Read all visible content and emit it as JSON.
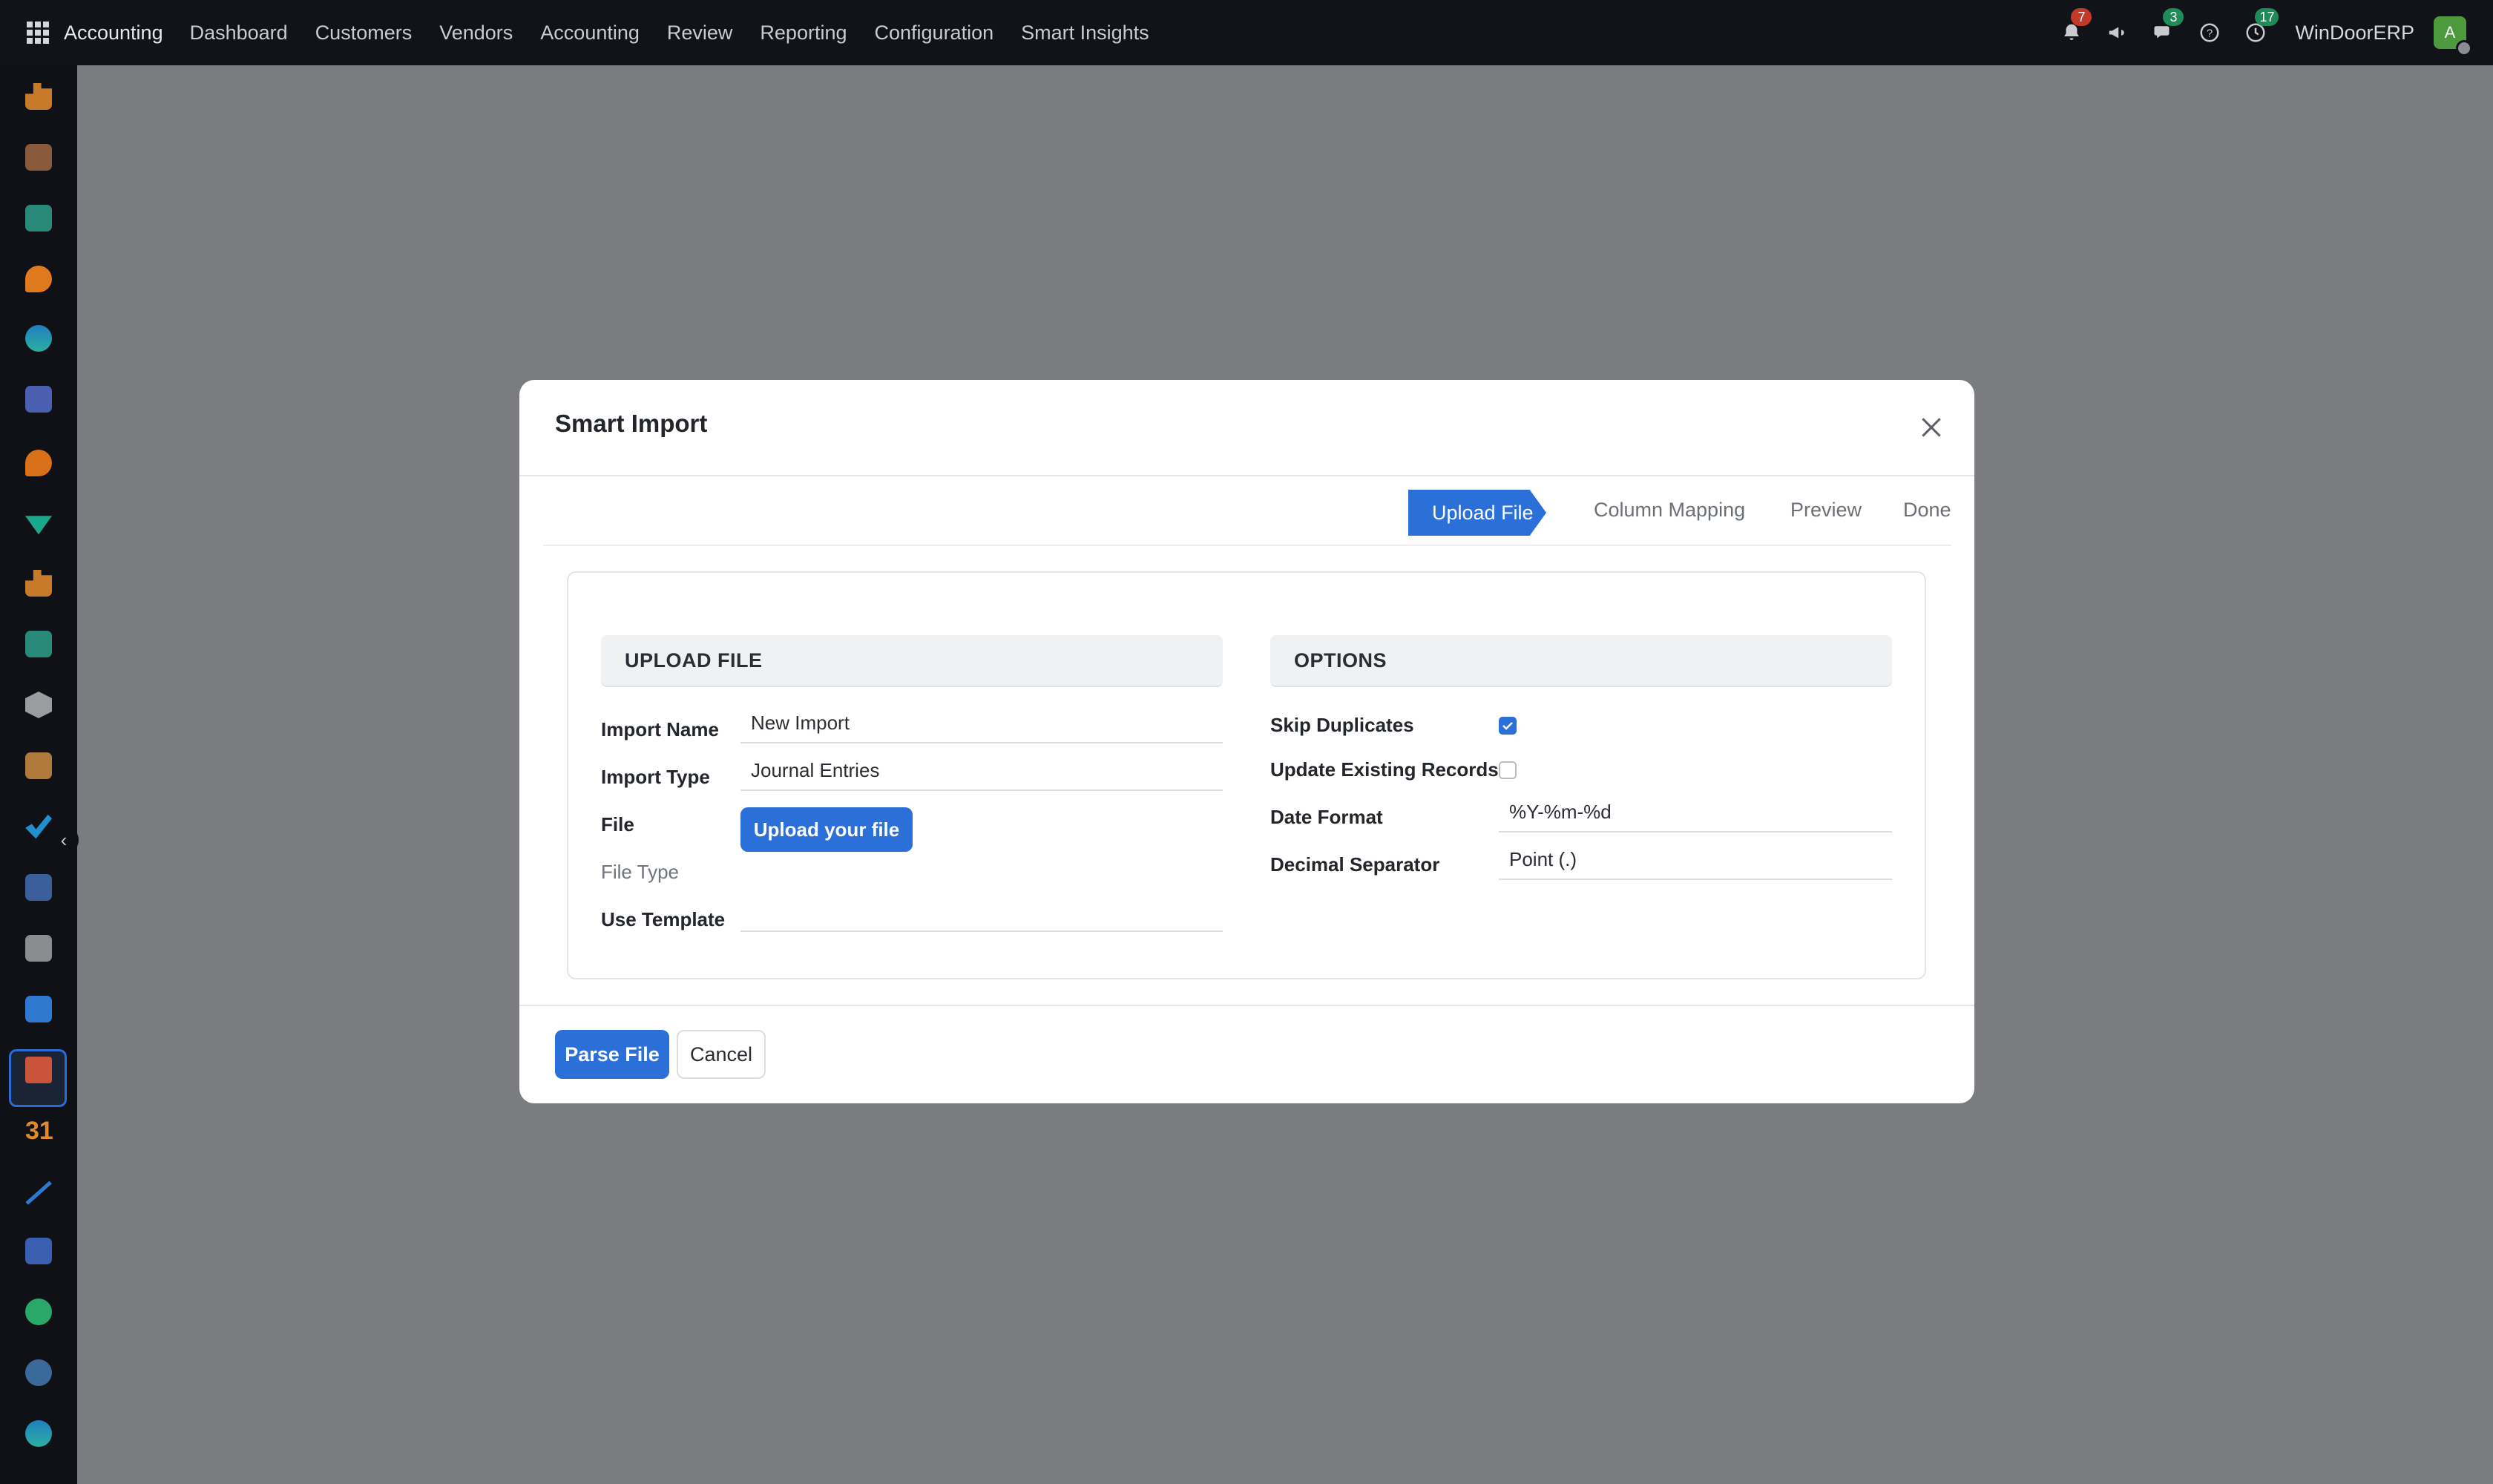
{
  "topbar": {
    "app_name": "Accounting",
    "nav": [
      "Dashboard",
      "Customers",
      "Vendors",
      "Accounting",
      "Review",
      "Reporting",
      "Configuration",
      "Smart Insights"
    ],
    "notifications_count": "7",
    "messages_count": "3",
    "activities_count": "17",
    "company": "WinDoorERP",
    "avatar_initial": "A"
  },
  "modal": {
    "title": "Smart Import",
    "steps": {
      "upload": "Upload File",
      "mapping": "Column Mapping",
      "preview": "Preview",
      "done": "Done"
    },
    "upload_section": {
      "title": "UPLOAD FILE",
      "import_name_label": "Import Name",
      "import_name_value": "New Import",
      "import_type_label": "Import Type",
      "import_type_value": "Journal Entries",
      "file_label": "File",
      "upload_button": "Upload your file",
      "file_type_label": "File Type",
      "use_template_label": "Use Template",
      "use_template_value": ""
    },
    "options_section": {
      "title": "OPTIONS",
      "skip_duplicates_label": "Skip Duplicates",
      "skip_duplicates_checked": true,
      "update_existing_label": "Update Existing Records",
      "update_existing_checked": false,
      "date_format_label": "Date Format",
      "date_format_value": "%Y-%m-%d",
      "decimal_separator_label": "Decimal Separator",
      "decimal_separator_value": "Point (.)"
    },
    "footer": {
      "parse_button": "Parse File",
      "cancel_button": "Cancel"
    }
  },
  "colors": {
    "primary": "#2b6fd8",
    "topbar_bg": "#111318",
    "overlay": "#7a7c80"
  }
}
